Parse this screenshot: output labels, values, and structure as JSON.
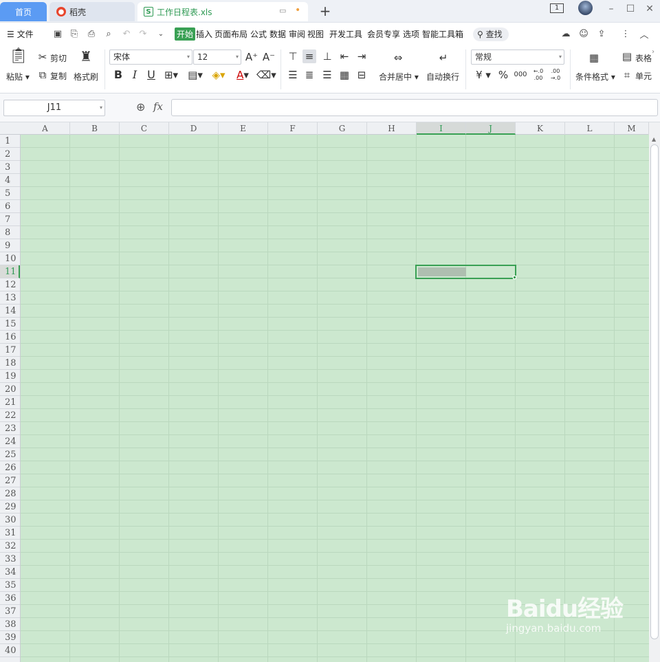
{
  "tabs": {
    "home": "首页",
    "daoke": "稻壳",
    "file": "工作日程表.xls",
    "add": "+"
  },
  "window": {
    "badge": "1",
    "minimize": "–",
    "maximize": "☐",
    "close": "✕"
  },
  "menu": {
    "file": "文件",
    "items": [
      "开始",
      "插入",
      "页面布局",
      "公式",
      "数据",
      "审阅",
      "视图",
      "开发工具",
      "会员专享",
      "选项",
      "智能工具箱"
    ],
    "search": "查找"
  },
  "ribbon": {
    "paste": "粘贴",
    "cut": "剪切",
    "copy": "复制",
    "format_painter": "格式刷",
    "font_name": "宋体",
    "font_size": "12",
    "bold": "B",
    "italic": "I",
    "underline": "U",
    "font_color_glyph": "A",
    "merge_center": "合并居中",
    "wrap_text": "自动换行",
    "number_format": "常规",
    "currency": "¥",
    "percent": "%",
    "thousands": "000",
    "dec_inc": "←.0 .00",
    "dec_dec": ".00 →.0",
    "conditional_format": "条件格式",
    "table_style": "表格",
    "cell": "单元"
  },
  "formula_bar": {
    "name_box": "J11",
    "fx": "fx",
    "value": ""
  },
  "sheet": {
    "columns": [
      "A",
      "B",
      "C",
      "D",
      "E",
      "F",
      "G",
      "H",
      "I",
      "J",
      "K",
      "L",
      "M"
    ],
    "rows": [
      "1",
      "2",
      "3",
      "4",
      "5",
      "6",
      "7",
      "8",
      "9",
      "10",
      "11",
      "12",
      "13",
      "14",
      "15",
      "16",
      "17",
      "18",
      "19",
      "20",
      "21",
      "22",
      "23",
      "24",
      "25",
      "26",
      "27",
      "28",
      "29",
      "30",
      "31",
      "32",
      "33",
      "34",
      "35",
      "36",
      "37",
      "38",
      "39",
      "40"
    ],
    "active_cell": "J11",
    "selected_range": "I11:J11"
  },
  "watermark": {
    "brand": "Baidu经验",
    "url": "jingyan.baidu.com"
  },
  "colors": {
    "accent": "#39a054",
    "grid_bg": "#cce8cf",
    "home_tab": "#5b9bf3"
  }
}
